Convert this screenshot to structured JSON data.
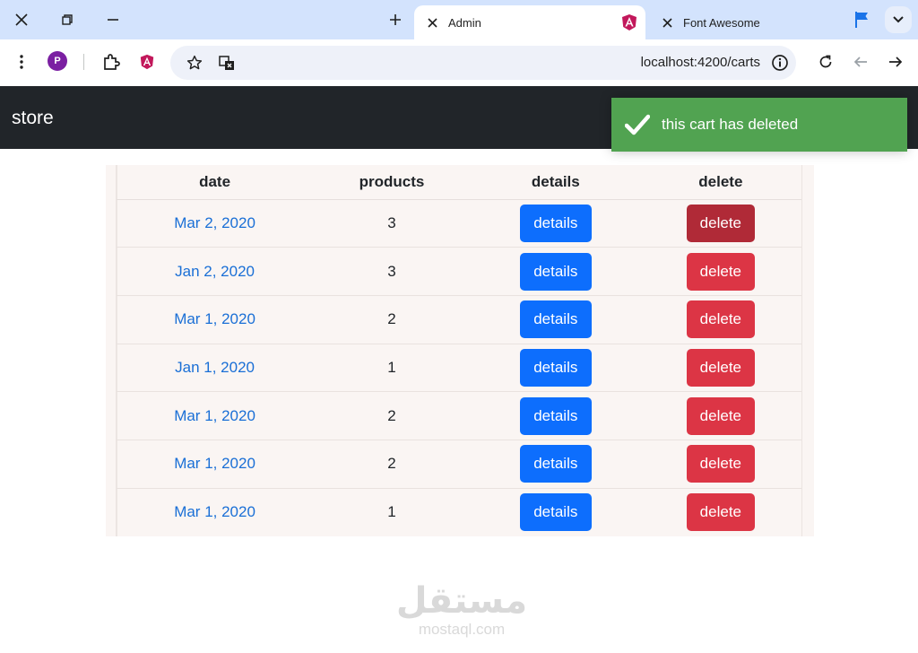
{
  "browser": {
    "tabs": [
      {
        "title": "Admin",
        "active": true
      },
      {
        "title": "Font Awesome",
        "active": false
      }
    ],
    "profile_initial": "P",
    "url": "localhost:4200/carts"
  },
  "app": {
    "brand": "store",
    "table": {
      "headers": {
        "date": "date",
        "products": "products",
        "details": "details",
        "delete": "delete"
      },
      "rows": [
        {
          "date": "Mar 2, 2020",
          "products": "3",
          "details_label": "details",
          "delete_label": "delete"
        },
        {
          "date": "Jan 2, 2020",
          "products": "3",
          "details_label": "details",
          "delete_label": "delete"
        },
        {
          "date": "Mar 1, 2020",
          "products": "2",
          "details_label": "details",
          "delete_label": "delete"
        },
        {
          "date": "Jan 1, 2020",
          "products": "1",
          "details_label": "details",
          "delete_label": "delete"
        },
        {
          "date": "Mar 1, 2020",
          "products": "2",
          "details_label": "details",
          "delete_label": "delete"
        },
        {
          "date": "Mar 1, 2020",
          "products": "2",
          "details_label": "details",
          "delete_label": "delete"
        },
        {
          "date": "Mar 1, 2020",
          "products": "1",
          "details_label": "details",
          "delete_label": "delete"
        }
      ]
    },
    "toast": {
      "message": "this cart has deleted"
    }
  },
  "watermark": {
    "arabic": "مستقل",
    "latin": "mostaql.com"
  },
  "colors": {
    "navbar": "#212529",
    "details_button": "#0d6efd",
    "delete_button": "#dc3545",
    "delete_button_pressed": "#b02a37",
    "toast_success": "#51a351",
    "link_date": "#1a6fd6"
  }
}
